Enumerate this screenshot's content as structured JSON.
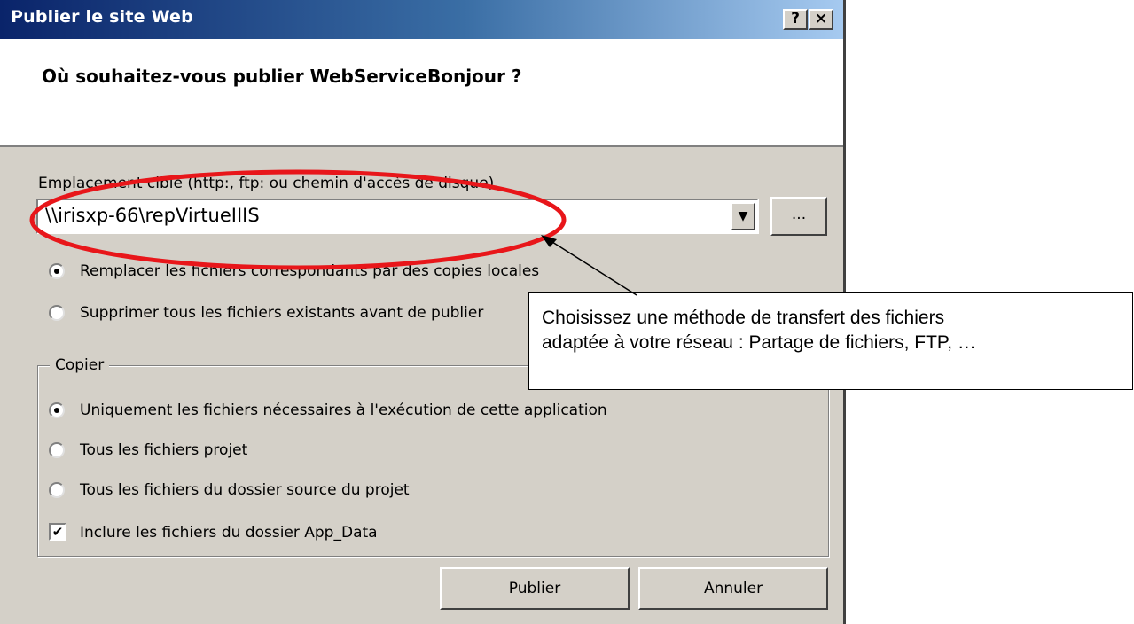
{
  "window": {
    "title": "Publier le site Web",
    "help_button": "?",
    "close_button": "×"
  },
  "header": {
    "question": "Où souhaitez-vous publier WebServiceBonjour ?"
  },
  "target": {
    "label": "Emplacement cible (http:, ftp: ou chemin d'accès de disque)",
    "value": "\\\\irisxp-66\\repVirtueIIIS",
    "browse_label": "..."
  },
  "options": {
    "replace_label": "Remplacer les fichiers correspondants par des copies locales",
    "replace_selected": true,
    "delete_label": "Supprimer tous les fichiers existants avant de publier",
    "delete_selected": false
  },
  "copy_group": {
    "legend": "Copier",
    "items": [
      {
        "label": "Uniquement les fichiers nécessaires à l'exécution de cette application",
        "selected": true
      },
      {
        "label": "Tous les fichiers projet",
        "selected": false
      },
      {
        "label": "Tous les fichiers du dossier source du projet",
        "selected": false
      }
    ],
    "include_app_data_label": "Inclure les fichiers du dossier App_Data",
    "include_app_data_checked": true
  },
  "buttons": {
    "publish": "Publier",
    "cancel": "Annuler"
  },
  "annotation": {
    "line1": "Choisissez une méthode de transfert des fichiers",
    "line2": "adaptée à votre réseau : Partage de fichiers, FTP, …",
    "highlight_color": "#e8161a"
  }
}
